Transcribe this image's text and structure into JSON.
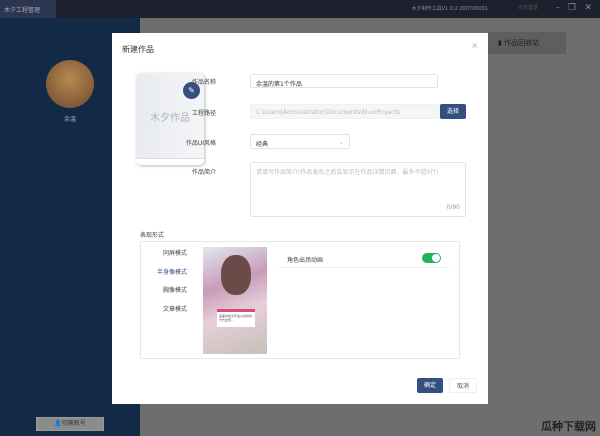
{
  "titlebar": {
    "app": "木夕工程管理",
    "version": "木夕制作工具V1.0.2.200706001",
    "user": "点击登录"
  },
  "sidebar": {
    "username": "余温",
    "switch_account": "切换账号"
  },
  "recycle": "作品回收站",
  "modal": {
    "title": "新建作品",
    "close": "×",
    "cover_text": "木夕作品",
    "edit_icon": "✎",
    "name_label": "作品名称",
    "name_value": "余温的第1个作品",
    "path_label": "工程路径",
    "path_value": "C:\\Users\\Administrator\\Documents\\MuxiProjects",
    "choose": "选择",
    "style_label": "作品UI风格",
    "style_value": "经典",
    "intro_label": "作品简介",
    "intro_placeholder": "请填写作品简介(作品发布之后会显示在作品详情页面，最多不超5行)",
    "intro_count": "0/90",
    "section": "表现形式",
    "modes": [
      "同屏模式",
      "半身像模式",
      "胸像模式",
      "文章模式"
    ],
    "preview_dialog": "画面中的文字会以这样的方式出现…",
    "option": "角色出场动画",
    "option_on": true,
    "ok": "确定",
    "cancel": "取消"
  },
  "watermark": "瓜种下载网"
}
